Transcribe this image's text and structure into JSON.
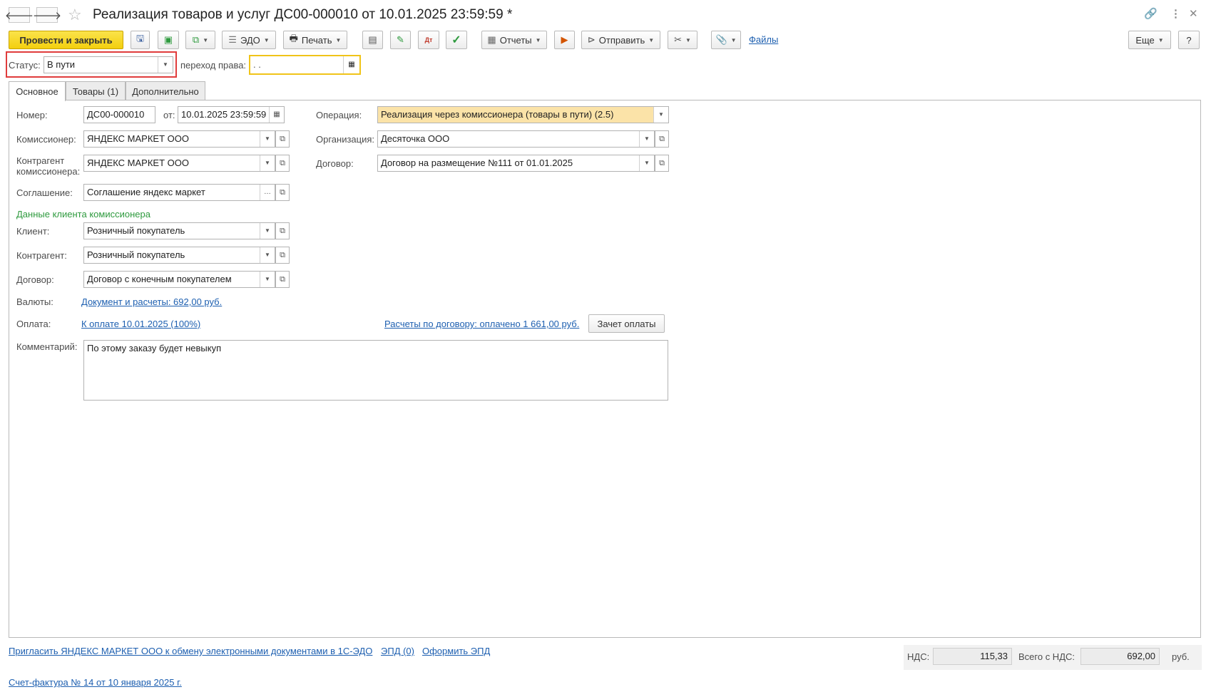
{
  "window": {
    "title": "Реализация товаров и услуг ДС00-000010 от 10.01.2025 23:59:59 *"
  },
  "toolbar": {
    "post_close": "Провести и закрыть",
    "edo": "ЭДО",
    "print": "Печать",
    "reports": "Отчеты",
    "send": "Отправить",
    "files": "Файлы",
    "more": "Еще",
    "help": "?"
  },
  "status": {
    "label": "Статус:",
    "value": "В пути",
    "transfer_label": "переход права:",
    "transfer_value": " .  ."
  },
  "tabs": [
    "Основное",
    "Товары (1)",
    "Дополнительно"
  ],
  "form": {
    "number_label": "Номер:",
    "number_value": "ДС00-000010",
    "from_label": "от:",
    "date_value": "10.01.2025 23:59:59",
    "commissioner_label": "Комиссионер:",
    "commissioner_value": "ЯНДЕКС МАРКЕТ ООО",
    "counterparty_label_1": "Контрагент",
    "counterparty_label_2": "комиссионера:",
    "counterparty_value": "ЯНДЕКС МАРКЕТ ООО",
    "agreement_label": "Соглашение:",
    "agreement_value": "Соглашение яндекс маркет",
    "operation_label": "Операция:",
    "operation_value": "Реализация через комиссионера (товары в пути) (2.5)",
    "org_label": "Организация:",
    "org_value": "Десяточка ООО",
    "contract_label": "Договор:",
    "contract_value": "Договор на размещение №111 от 01.01.2025",
    "client_section": "Данные клиента комиссионера",
    "client_label": "Клиент:",
    "client_value": "Розничный покупатель",
    "cp_label": "Контрагент:",
    "cp_value": "Розничный покупатель",
    "cp_contract_label": "Договор:",
    "cp_contract_value": "Договор с конечным покупателем",
    "currency_label": "Валюты:",
    "currency_link": "Документ и расчеты: 692,00 руб.",
    "payment_label": "Оплата:",
    "payment_link": "К оплате 10.01.2025 (100%)",
    "settlements_link": "Расчеты по договору: оплачено 1 661,00 руб.",
    "offset_button": "Зачет оплаты",
    "comment_label": "Комментарий:",
    "comment_value": "По этому заказу будет невыкуп"
  },
  "footer": {
    "invite_link": "Пригласить ЯНДЕКС МАРКЕТ ООО к обмену электронными документами в 1С-ЭДО",
    "epd_link": "ЭПД (0)",
    "make_epd_link": "Оформить ЭПД",
    "invoice_link": "Счет-фактура № 14 от 10 января 2025 г.",
    "vat_label": "НДС:",
    "vat_value": "115,33",
    "total_label": "Всего с НДС:",
    "total_value": "692,00",
    "currency": "руб."
  },
  "colors": {
    "primary_button": "#f5d317",
    "highlight_border": "#e03c3c",
    "focus_border": "#f0c419",
    "operation_bg": "#fbe3a8",
    "link": "#1d5fb0",
    "section_green": "#2e9a3e"
  },
  "icons": {
    "back": "arrow-left-icon",
    "forward": "arrow-right-icon",
    "star": "star-icon",
    "link": "link-icon",
    "menu": "kebab-icon",
    "close": "close-icon"
  }
}
